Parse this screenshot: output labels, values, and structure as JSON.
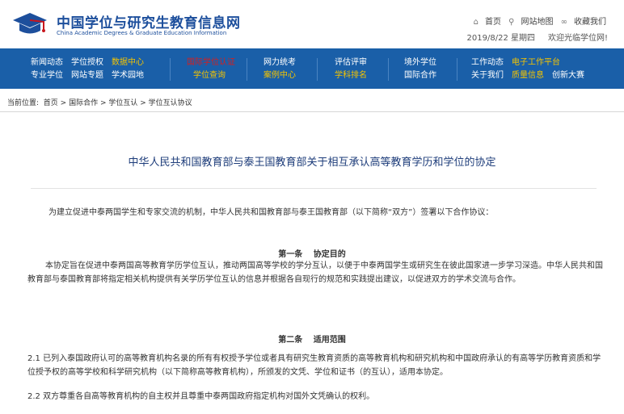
{
  "header": {
    "title": "中国学位与研究生教育信息网",
    "subtitle": "China Academic Degrees & Graduate Education Information",
    "links": {
      "home": "首页",
      "sitemap": "网站地图",
      "favorite": "收藏我们"
    },
    "date": "2019/8/22 星期四",
    "welcome": "欢迎光临学位网!"
  },
  "nav": {
    "col1": [
      "新闻动态",
      "学位授权",
      "数据中心",
      "专业学位",
      "网站专题",
      "学术园地"
    ],
    "col2": [
      "国际学位认证",
      "学位查询"
    ],
    "col3": [
      "网力统考",
      "案例中心"
    ],
    "col4": [
      "评估评审",
      "学科排名"
    ],
    "col5": [
      "境外学位",
      "国际合作"
    ],
    "col6": [
      "工作动态",
      "电子工作平台",
      "关于我们",
      "质量信息",
      "创新大赛"
    ]
  },
  "breadcrumb": {
    "label": "当前位置:",
    "items": [
      "首页",
      "国际合作",
      "学位互认",
      "学位互认协议"
    ]
  },
  "article": {
    "title": "中华人民共和国教育部与泰王国教育部关于相互承认高等教育学历和学位的协定",
    "intro": "为建立促进中泰两国学生和专家交流的机制，中华人民共和国教育部与泰王国教育部（以下简称“双方”）签署以下合作协议：",
    "section1_title": "第一条　 协定目的",
    "section1_text": "本协定旨在促进中泰两国高等教育学历学位互认，推动两国高等学校的学分互认，以便于中泰两国学生或研究生在彼此国家进一步学习深造。中华人民共和国教育部与泰国教育部将指定相关机构提供有关学历学位互认的信息并根据各自现行的规范和实践提出建议，以促进双方的学术交流与合作。",
    "section2_title": "第二条　 适用范围",
    "section2_p1": "2.1 已列入泰国政府认可的高等教育机构名录的所有有权授予学位或者具有研究生教育资质的高等教育机构和研究机构和中国政府承认的有高等学历教育资质和学位授予权的高等学校和科学研究机构（以下简称高等教育机构），所颁发的文凭、学位和证书（的互认），适用本协定。",
    "section2_p2": "2.2 双方尊重各自高等教育机构的自主权并且尊重中泰两国政府指定机构对国外文凭确认的权利。"
  },
  "colors": {
    "nav_bg": "#1a5fa8",
    "highlight": "#f5c400",
    "brand": "#1d4f9c"
  }
}
